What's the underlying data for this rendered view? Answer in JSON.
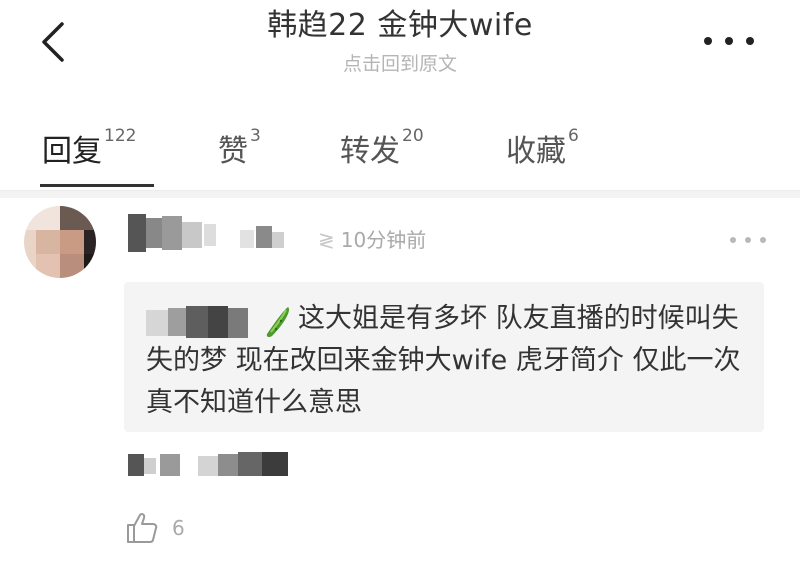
{
  "header": {
    "title": "韩趋22 金钟大wife",
    "subtitle": "点击回到原文"
  },
  "tabs": [
    {
      "label": "回复",
      "count": "122",
      "active": true
    },
    {
      "label": "赞",
      "count": "3",
      "active": false
    },
    {
      "label": "转发",
      "count": "20",
      "active": false
    },
    {
      "label": "收藏",
      "count": "6",
      "active": false
    }
  ],
  "comment": {
    "time": "10分钟前",
    "quote_text": "这大姐是有多坏 队友直播的时候叫失失的梦 现在改回来金钟大wife 虎牙简介 仅此一次 真不知道什么意思",
    "like_count": "6"
  },
  "icons": {
    "back": "chevron-left-icon",
    "more": "more-horizontal-icon",
    "like": "thumbs-up-icon",
    "emoji": "cucumber-emoji-icon"
  },
  "colors": {
    "text": "#222222",
    "muted": "#a9a9a9",
    "quote_bg": "#f4f4f4",
    "divider": "#f3f3f3"
  }
}
